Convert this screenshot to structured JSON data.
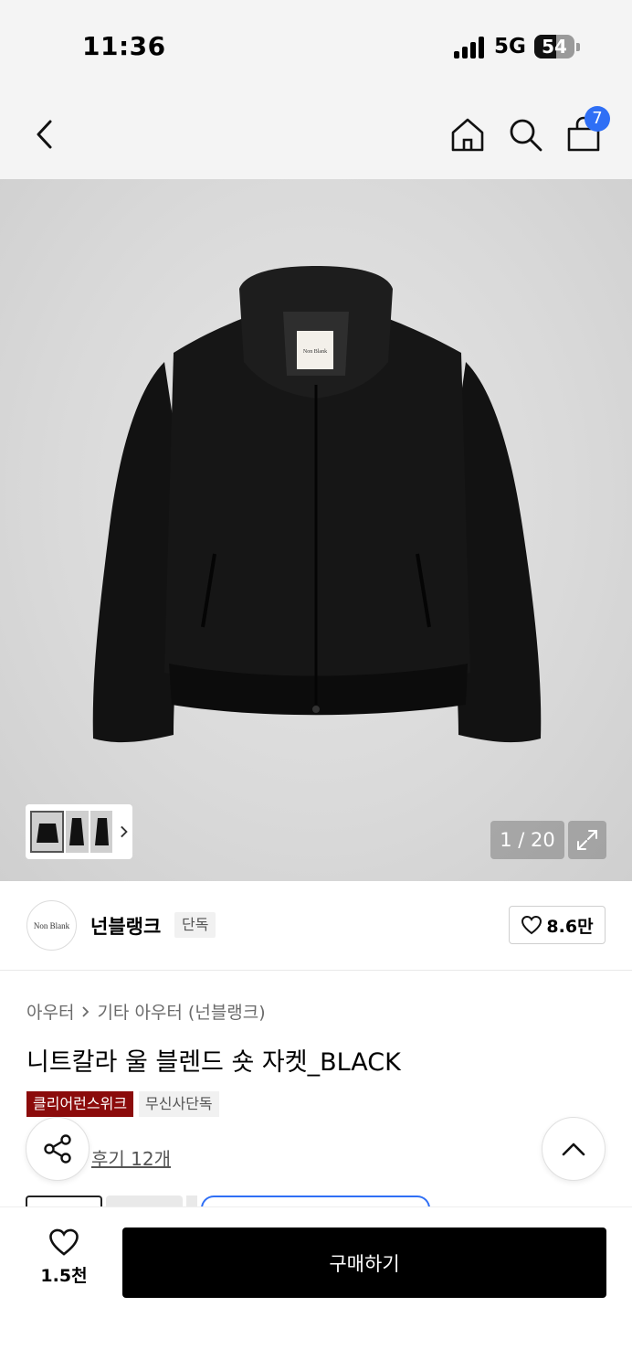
{
  "status_bar": {
    "time": "11:36",
    "network": "5G",
    "battery": "54",
    "battery_level": 0.54
  },
  "header": {
    "cart_count": "7",
    "icons": [
      "back-icon",
      "home-icon",
      "search-icon",
      "cart-icon"
    ]
  },
  "gallery": {
    "counter": "1 / 20",
    "jacket_label": "Non Blank",
    "thumbnail_count": 3
  },
  "brand": {
    "logo_text": "Non Blank",
    "name": "넌블랭크",
    "exclusive_tag": "단독",
    "likes": "8.6만"
  },
  "product": {
    "breadcrumb": [
      "아우터",
      "기타 아우터 (넌블랭크)"
    ],
    "title": "니트칼라 울 블렌드 숏 자켓_BLACK",
    "tags": [
      "클리어런스위크",
      "무신사단독"
    ],
    "review_link": "후기 12개"
  },
  "bottom_bar": {
    "wish_count": "1.5천",
    "buy_label": "구매하기"
  },
  "colors": {
    "accent_blue": "#2f6ff5",
    "tag_red": "#8b0b0b",
    "buy_button": "#000000"
  }
}
